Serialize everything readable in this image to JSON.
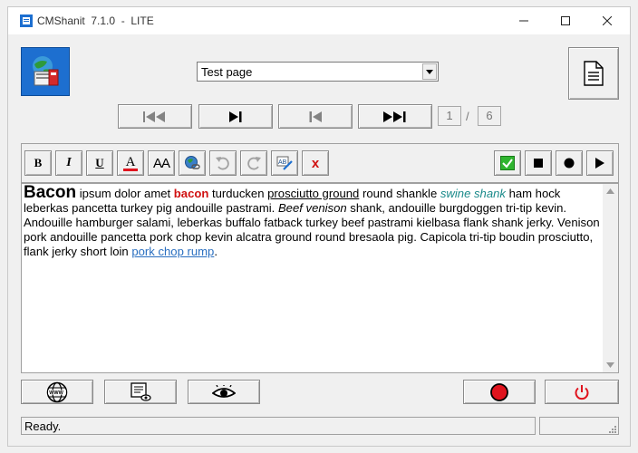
{
  "window": {
    "title": "CMShanit  7.1.0  -  LITE"
  },
  "page_selector": {
    "selected": "Test page"
  },
  "pager": {
    "current": "1",
    "separator": "/",
    "total": "6"
  },
  "editor": {
    "runs": [
      {
        "style": "big",
        "text": "Bacon"
      },
      {
        "style": "",
        "text": " ipsum dolor amet "
      },
      {
        "style": "red",
        "text": "bacon"
      },
      {
        "style": "",
        "text": " turducken "
      },
      {
        "style": "u",
        "text": "prosciutto ground"
      },
      {
        "style": "",
        "text": " round shankle "
      },
      {
        "style": "teal",
        "text": "swine shank"
      },
      {
        "style": "",
        "text": " ham hock leberkas pancetta turkey pig andouille pastrami. "
      },
      {
        "style": "i",
        "text": "Beef venison"
      },
      {
        "style": "",
        "text": " shank, andouille burgdoggen tri-tip kevin. Andouille hamburger salami, leberkas buffalo fatback turkey beef pastrami kielbasa flank shank jerky. Venison pork andouille pancetta pork chop kevin alcatra ground round bresaola pig. Capicola tri-tip boudin prosciutto, flank jerky short loin "
      },
      {
        "style": "link",
        "text": "pork chop rump"
      },
      {
        "style": "",
        "text": "."
      }
    ]
  },
  "toolbar": {
    "bold": "B",
    "italic": "I",
    "underline": "U",
    "font_color": "A",
    "font_size": "AA",
    "delete": "x"
  },
  "status": {
    "text": "Ready."
  },
  "colors": {
    "accent_blue": "#1d6fd0",
    "record_red": "#e0141e",
    "check_green": "#2fb52f"
  }
}
